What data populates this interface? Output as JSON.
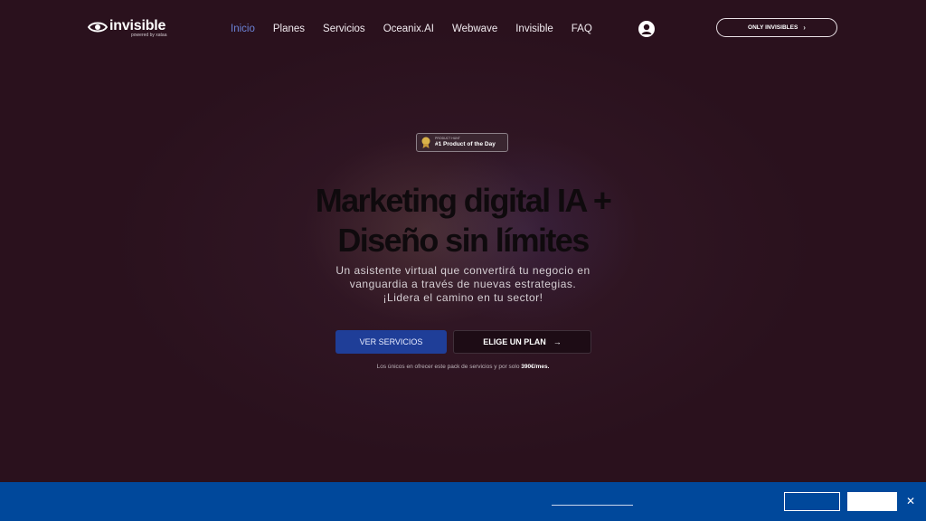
{
  "brand": {
    "name": "invisible",
    "tagline": "powered by xataa"
  },
  "nav": [
    {
      "label": "Inicio",
      "active": true
    },
    {
      "label": "Planes"
    },
    {
      "label": "Servicios"
    },
    {
      "label": "Oceanix.AI"
    },
    {
      "label": "Webwave"
    },
    {
      "label": "Invisible"
    },
    {
      "label": "FAQ"
    }
  ],
  "header": {
    "cta_label": "ONLY INVISIBLES"
  },
  "badge": {
    "line1": "PRODUCT HUNT",
    "line2": "#1 Product of the Day"
  },
  "hero": {
    "title_line1": "Marketing digital IA +",
    "title_line2": "Diseño sin límites",
    "subtitle_line1": "Un asistente virtual que convertirá tu negocio en",
    "subtitle_line2": "vanguardia a través de nuevas estrategias.",
    "subtitle_line3": "¡Lidera el camino en tu sector!",
    "primary_button": "VER SERVICIOS",
    "secondary_button": "ELIGE UN PLAN",
    "note_text": "Los únicos en ofrecer este pack de servicios y por solo",
    "note_price": "390€/mes."
  },
  "colors": {
    "background": "#2a111d",
    "accent": "#1f3e98",
    "active_nav": "#6b82d6",
    "cookie_bar": "#00489b"
  }
}
